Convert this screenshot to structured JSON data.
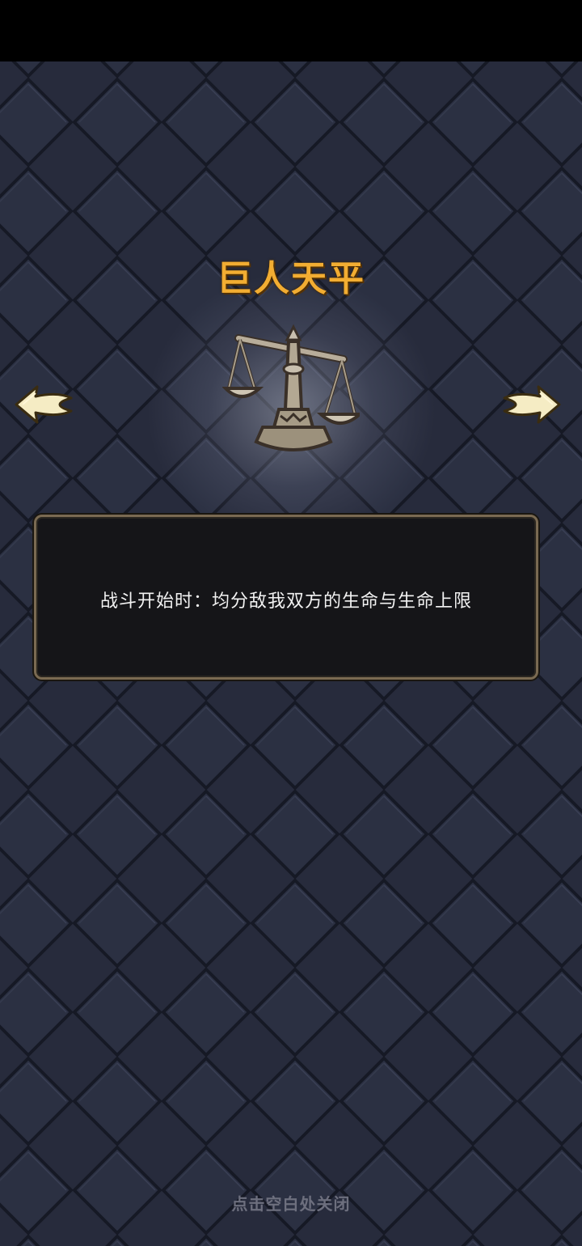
{
  "relic": {
    "title": "巨人天平",
    "icon": "scale-icon",
    "description": "战斗开始时：均分敌我双方的生命与生命上限"
  },
  "navigation": {
    "prev_icon": "arrow-left-icon",
    "next_icon": "arrow-right-icon"
  },
  "footer": {
    "close_hint": "点击空白处关闭"
  },
  "colors": {
    "title": "#f2ad32",
    "background": "#262a3b",
    "panel_border": "#7a6a52",
    "hint": "#6d6f7e"
  }
}
